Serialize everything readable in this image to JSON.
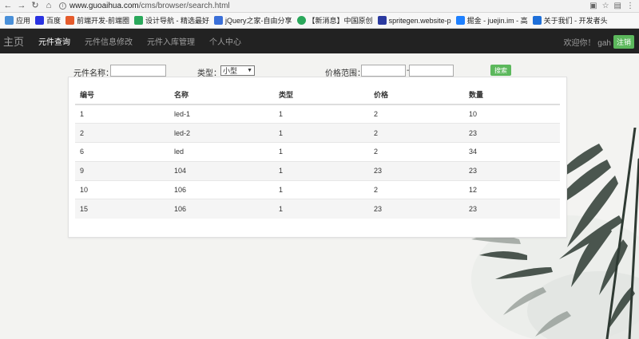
{
  "browser": {
    "url_host": "www.guoaihua.com",
    "url_path": "/cms/browser/search.html",
    "bookmarks": [
      {
        "label": "应用",
        "color": "#4a90d9"
      },
      {
        "label": "百度",
        "color": "#2932e1"
      },
      {
        "label": "前端开发-前端圈",
        "color": "#e55b2c"
      },
      {
        "label": "设计导航 - 精选最好",
        "color": "#2aa85b"
      },
      {
        "label": "jQuery之家-自由分享",
        "color": "#3a6fd8"
      },
      {
        "label": "【新消息】中国原创",
        "color": "#2aa85b"
      },
      {
        "label": "spritegen.website-p",
        "color": "#2b3aa0"
      },
      {
        "label": "掘金 - juejin.im - 高",
        "color": "#1e80ff"
      },
      {
        "label": "关于我们 - 开发者头",
        "color": "#1e6fd9"
      }
    ]
  },
  "nav": {
    "brand": "主页",
    "items": [
      "元件查询",
      "元件信息修改",
      "元件入库管理",
      "个人中心"
    ],
    "welcome": "欢迎你！ gah",
    "logout": "注销"
  },
  "search": {
    "name_label": "元件名称：",
    "type_label": "类型：",
    "type_selected": "小型",
    "price_label": "价格范围：",
    "dash": "-",
    "button": "搜索"
  },
  "table": {
    "headers": [
      "编号",
      "名称",
      "类型",
      "价格",
      "数量"
    ],
    "rows": [
      [
        "1",
        "led-1",
        "1",
        "2",
        "10"
      ],
      [
        "2",
        "led-2",
        "1",
        "2",
        "23"
      ],
      [
        "6",
        "led",
        "1",
        "2",
        "34"
      ],
      [
        "9",
        "104",
        "1",
        "23",
        "23"
      ],
      [
        "10",
        "106",
        "1",
        "2",
        "12"
      ],
      [
        "15",
        "106",
        "1",
        "23",
        "23"
      ]
    ]
  },
  "colors": {
    "navbar": "#222222",
    "accent": "#5cb85c"
  }
}
